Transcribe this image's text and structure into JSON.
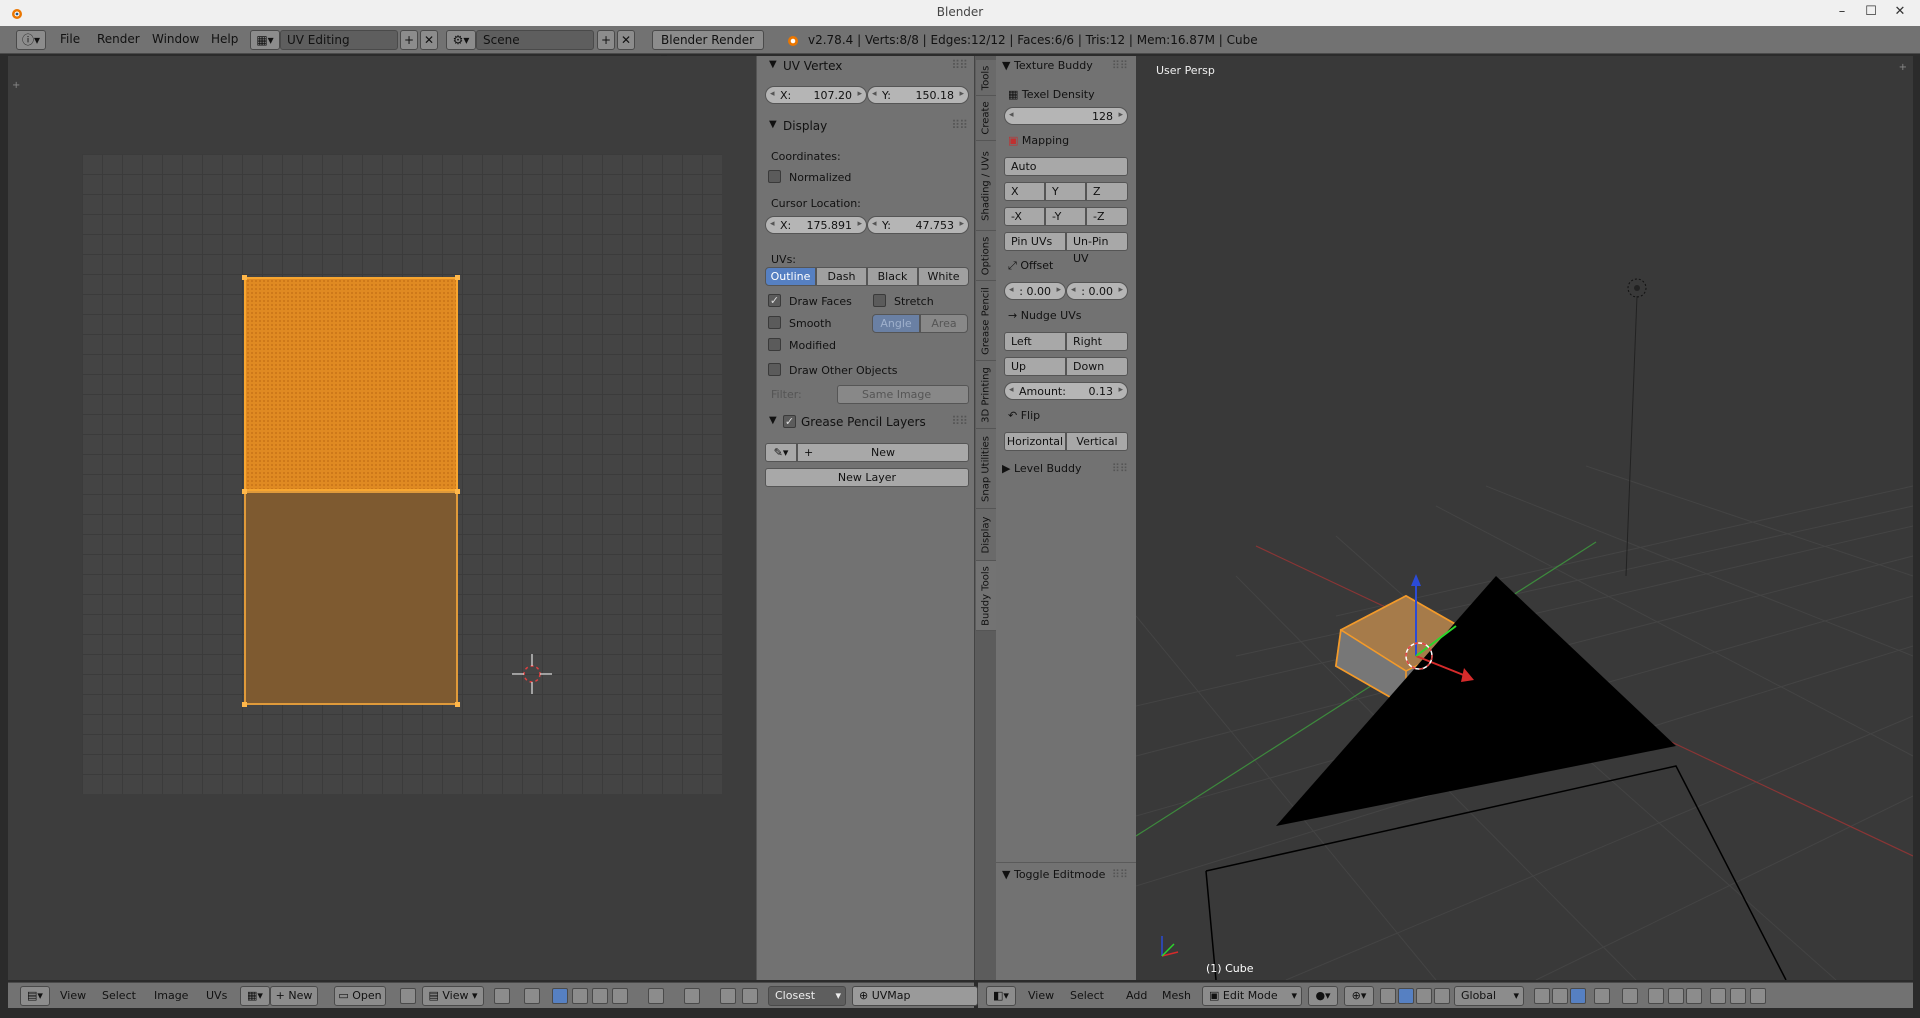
{
  "window": {
    "title": "Blender",
    "minimize": "–",
    "maximize": "☐",
    "close": "✕"
  },
  "topbar": {
    "menus": [
      "File",
      "Render",
      "Window",
      "Help"
    ],
    "screen_layout": "UV Editing",
    "scene": "Scene",
    "render_engine": "Blender Render",
    "stats": "v2.78.4 | Verts:8/8 | Edges:12/12 | Faces:6/6 | Tris:12 | Mem:16.87M | Cube"
  },
  "uv_props": {
    "uv_vertex": {
      "title": "UV Vertex",
      "x_label": "X:",
      "x": "107.20",
      "y_label": "Y:",
      "y": "150.18"
    },
    "display": {
      "title": "Display",
      "coordinates_label": "Coordinates:",
      "normalized": "Normalized",
      "cursor_location_label": "Cursor Location:",
      "cursor_x_label": "X:",
      "cursor_x": "175.891",
      "cursor_y_label": "Y:",
      "cursor_y": "47.753",
      "uvs_label": "UVs:",
      "uv_modes": [
        "Outline",
        "Dash",
        "Black",
        "White"
      ],
      "draw_faces": "Draw Faces",
      "stretch": "Stretch",
      "smooth": "Smooth",
      "angle": "Angle",
      "area": "Area",
      "modified": "Modified",
      "draw_other_objects": "Draw Other Objects",
      "filter_label": "Filter:",
      "filter_value": "Same Image"
    },
    "grease_pencil": {
      "title": "Grease Pencil Layers",
      "new": "New",
      "new_layer": "New Layer"
    }
  },
  "vtabs": [
    "Tools",
    "Create",
    "Shading / UVs",
    "Options",
    "Grease Pencil",
    "3D Printing",
    "Snap Utilities",
    "Display",
    "Buddy Tools"
  ],
  "toolpanel": {
    "texture_buddy": "Texture Buddy",
    "texel_density_label": "Texel Density",
    "texel_density": "128",
    "mapping": "Mapping",
    "auto": "Auto",
    "axes": [
      "X",
      "Y",
      "Z"
    ],
    "neg_axes": [
      "-X",
      "-Y",
      "-Z"
    ],
    "pin_uvs": "Pin UVs",
    "unpin_uv": "Un-Pin UV",
    "offset": "Offset",
    "offset_a": ": 0.00",
    "offset_b": ": 0.00",
    "nudge_uvs": "Nudge UVs",
    "left": "Left",
    "right": "Right",
    "up": "Up",
    "down": "Down",
    "amount_label": "Amount:",
    "amount": "0.13",
    "flip": "Flip",
    "horizontal": "Horizontal",
    "vertical": "Vertical",
    "level_buddy": "Level Buddy",
    "toggle_editmode": "Toggle Editmode"
  },
  "viewport": {
    "view_label": "User Persp",
    "object_label": "(1) Cube"
  },
  "uv_bottombar": {
    "menus": [
      "View",
      "Select",
      "Image",
      "UVs"
    ],
    "new": "New",
    "open": "Open",
    "view": "View",
    "snap": "Closest",
    "uvmap": "UVMap"
  },
  "vp_bottombar": {
    "menus": [
      "View",
      "Select",
      "Add",
      "Mesh"
    ],
    "mode": "Edit Mode",
    "orientation": "Global"
  },
  "colors": {
    "accent": "#5680c2",
    "uv_selected": "#e08a22",
    "uv_unselected": "#7e5a30",
    "panel": "#727272"
  }
}
